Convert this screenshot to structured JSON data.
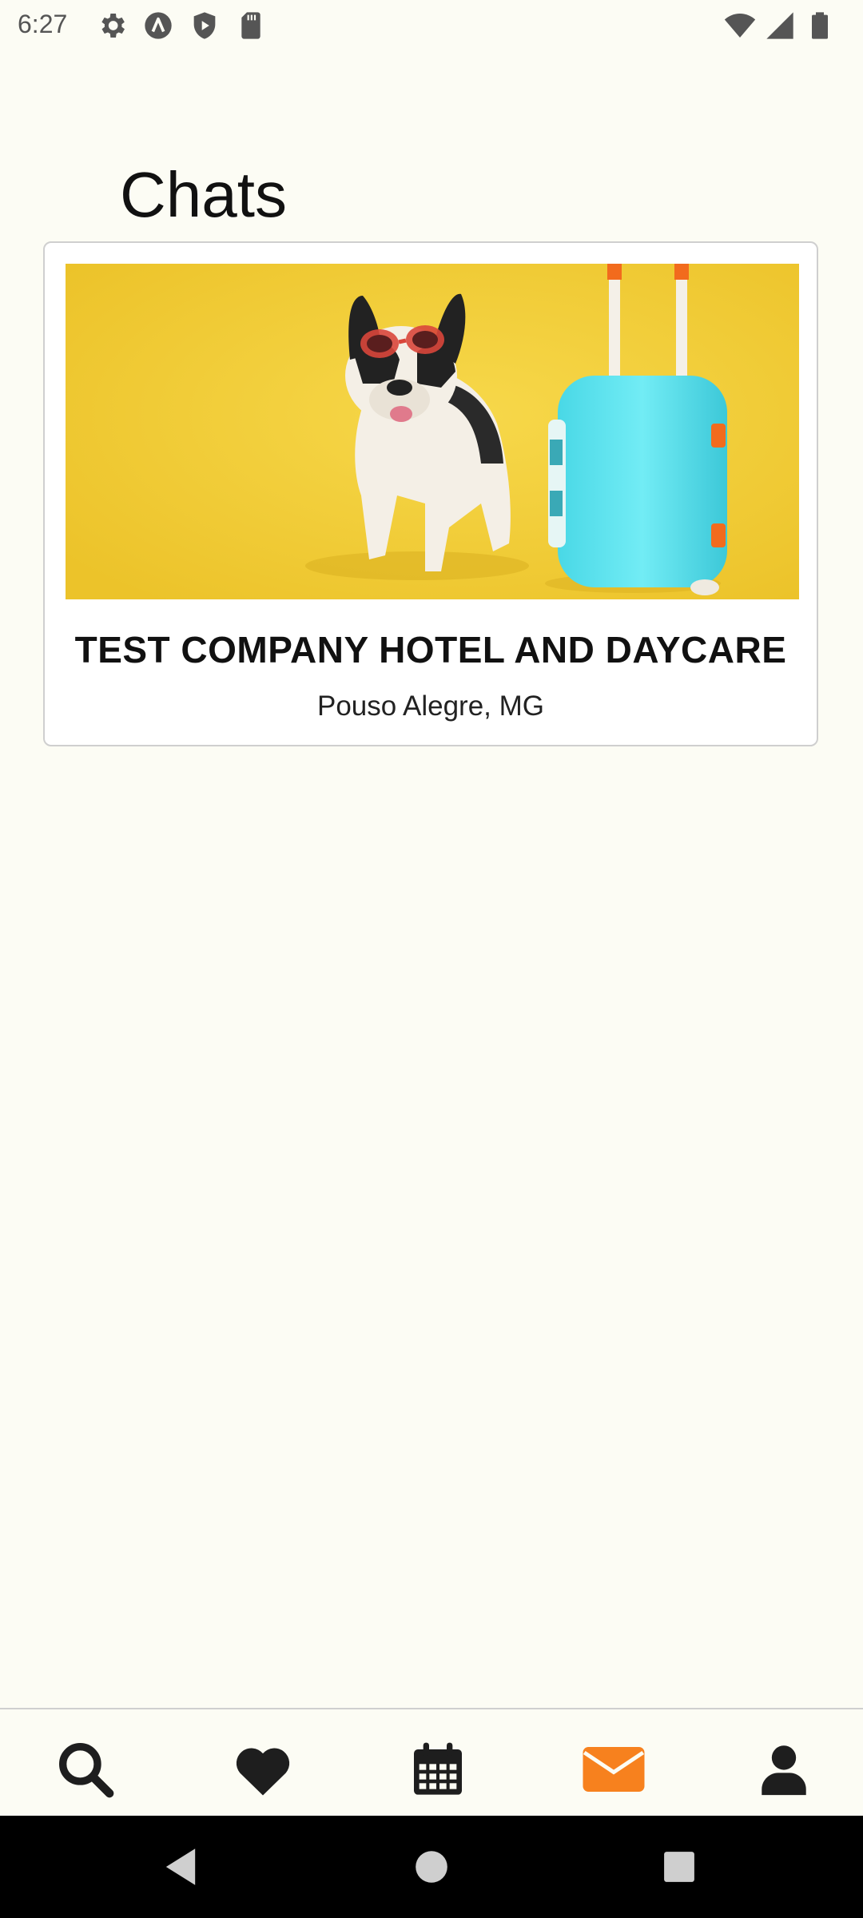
{
  "status_bar": {
    "time": "6:27",
    "left_icons": [
      "settings-icon",
      "app-a-icon",
      "shield-play-icon",
      "sd-card-icon"
    ],
    "right_icons": [
      "wifi-icon",
      "signal-icon",
      "battery-icon"
    ]
  },
  "header": {
    "title": "Chats"
  },
  "chats": [
    {
      "name": "TEST COMPANY HOTEL AND DAYCARE",
      "location": "Pouso Alegre, MG",
      "image": "french bulldog with sunglasses beside turquoise suitcase on yellow background"
    }
  ],
  "bottom_nav": {
    "items": [
      {
        "icon": "search-icon",
        "active": false
      },
      {
        "icon": "heart-icon",
        "active": false
      },
      {
        "icon": "calendar-icon",
        "active": false
      },
      {
        "icon": "mail-icon",
        "active": true
      },
      {
        "icon": "user-icon",
        "active": false
      }
    ],
    "active_color": "#f7811e",
    "inactive_color": "#1e1e1e"
  },
  "system_nav": {
    "buttons": [
      "back-icon",
      "home-icon",
      "recents-icon"
    ]
  }
}
